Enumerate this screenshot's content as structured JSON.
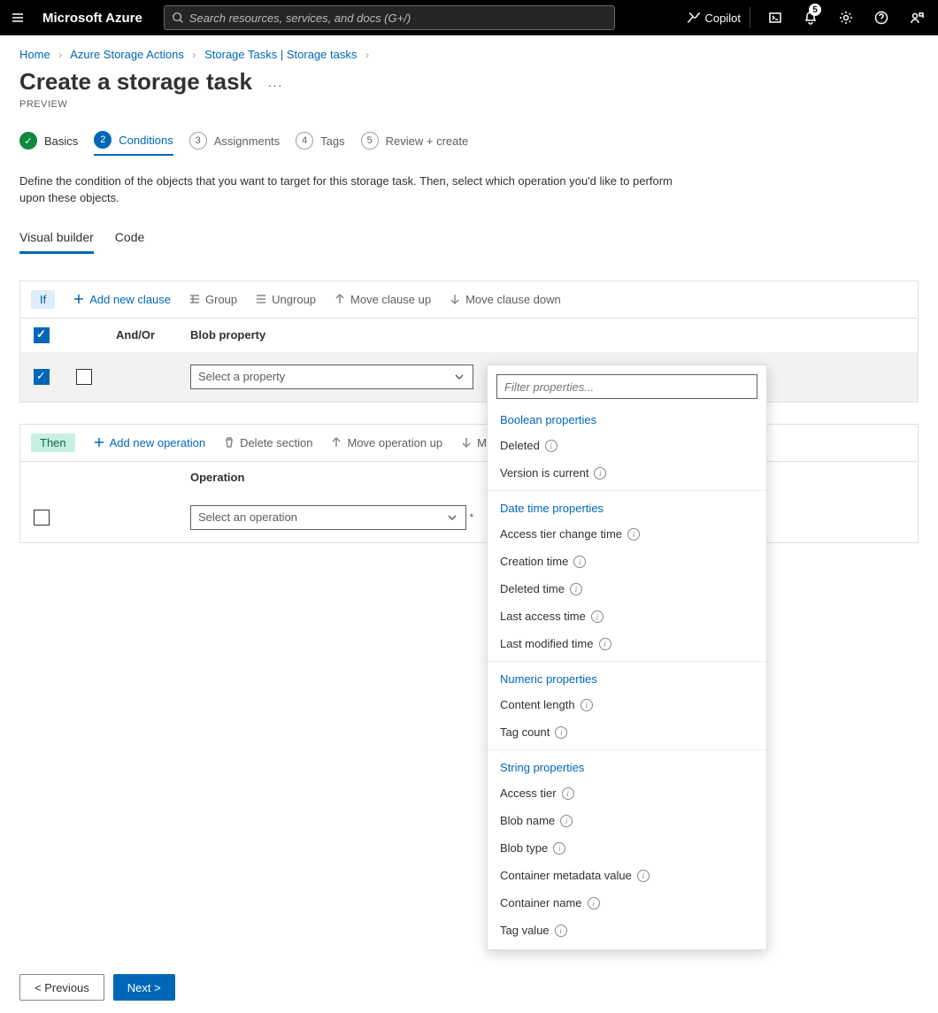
{
  "topbar": {
    "brand": "Microsoft Azure",
    "search_placeholder": "Search resources, services, and docs (G+/)",
    "copilot": "Copilot",
    "notif_count": "5"
  },
  "breadcrumb": {
    "items": [
      "Home",
      "Azure Storage Actions",
      "Storage Tasks | Storage tasks"
    ]
  },
  "title": {
    "heading": "Create a storage task",
    "preview": "PREVIEW"
  },
  "wizard": {
    "tabs": [
      {
        "label": "Basics"
      },
      {
        "num": "2",
        "label": "Conditions"
      },
      {
        "num": "3",
        "label": "Assignments"
      },
      {
        "num": "4",
        "label": "Tags"
      },
      {
        "num": "5",
        "label": "Review + create"
      }
    ]
  },
  "description": "Define the condition of the objects that you want to target for this storage task. Then, select which operation you'd like to perform upon these objects.",
  "subtabs": {
    "visual": "Visual builder",
    "code": "Code"
  },
  "if_panel": {
    "chip": "If",
    "add": "Add new clause",
    "group": "Group",
    "ungroup": "Ungroup",
    "move_up": "Move clause up",
    "move_down": "Move clause down",
    "headers": {
      "andor": "And/Or",
      "prop": "Blob property"
    },
    "row": {
      "select_prop": "Select a property"
    }
  },
  "then_panel": {
    "chip": "Then",
    "add": "Add new operation",
    "del": "Delete section",
    "move_up": "Move operation up",
    "move_down_initial": "M",
    "headers": {
      "op": "Operation"
    },
    "row": {
      "select_op": "Select an operation"
    }
  },
  "dropdown": {
    "filter_placeholder": "Filter properties...",
    "groups": [
      {
        "title": "Boolean properties",
        "items": [
          "Deleted",
          "Version is current"
        ]
      },
      {
        "title": "Date time properties",
        "items": [
          "Access tier change time",
          "Creation time",
          "Deleted time",
          "Last access time",
          "Last modified time"
        ]
      },
      {
        "title": "Numeric properties",
        "items": [
          "Content length",
          "Tag count"
        ]
      },
      {
        "title": "String properties",
        "items": [
          "Access tier",
          "Blob name",
          "Blob type",
          "Container metadata value",
          "Container name",
          "Tag value"
        ]
      }
    ]
  },
  "footer": {
    "prev": "< Previous",
    "next": "Next >"
  }
}
